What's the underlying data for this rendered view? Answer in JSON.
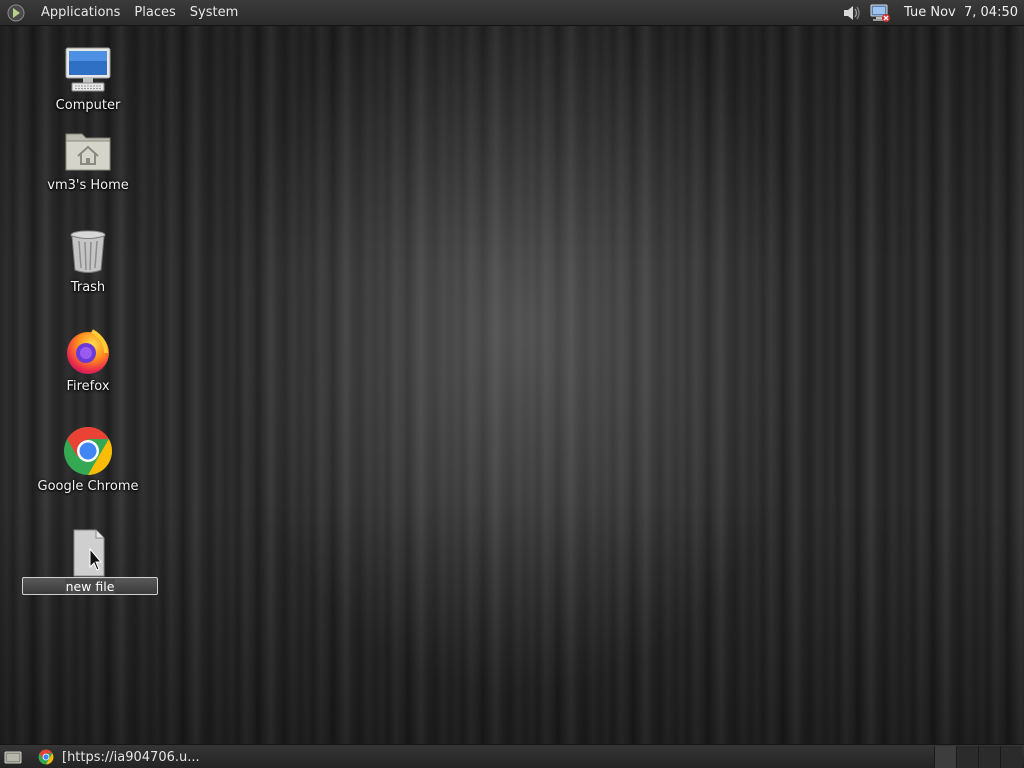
{
  "top_panel": {
    "menus": [
      "Applications",
      "Places",
      "System"
    ],
    "tray": {
      "volume_icon": "volume-icon",
      "network_icon": "network-disconnected-icon"
    },
    "clock": "Tue Nov  7, 04:50"
  },
  "desktop": {
    "icons": [
      {
        "label": "Computer",
        "icon": "computer-icon"
      },
      {
        "label": "vm3's Home",
        "icon": "home-folder-icon"
      },
      {
        "label": "Trash",
        "icon": "trash-icon"
      },
      {
        "label": "Firefox",
        "icon": "firefox-icon"
      },
      {
        "label": "Google Chrome",
        "icon": "chrome-icon"
      }
    ],
    "renaming_item": {
      "icon": "file-icon",
      "name_value": "new file"
    }
  },
  "bottom_panel": {
    "show_desktop_icon": "show-desktop-icon",
    "tasks": [
      {
        "icon": "chrome-icon",
        "label": "[https://ia904706.u..."
      }
    ]
  }
}
